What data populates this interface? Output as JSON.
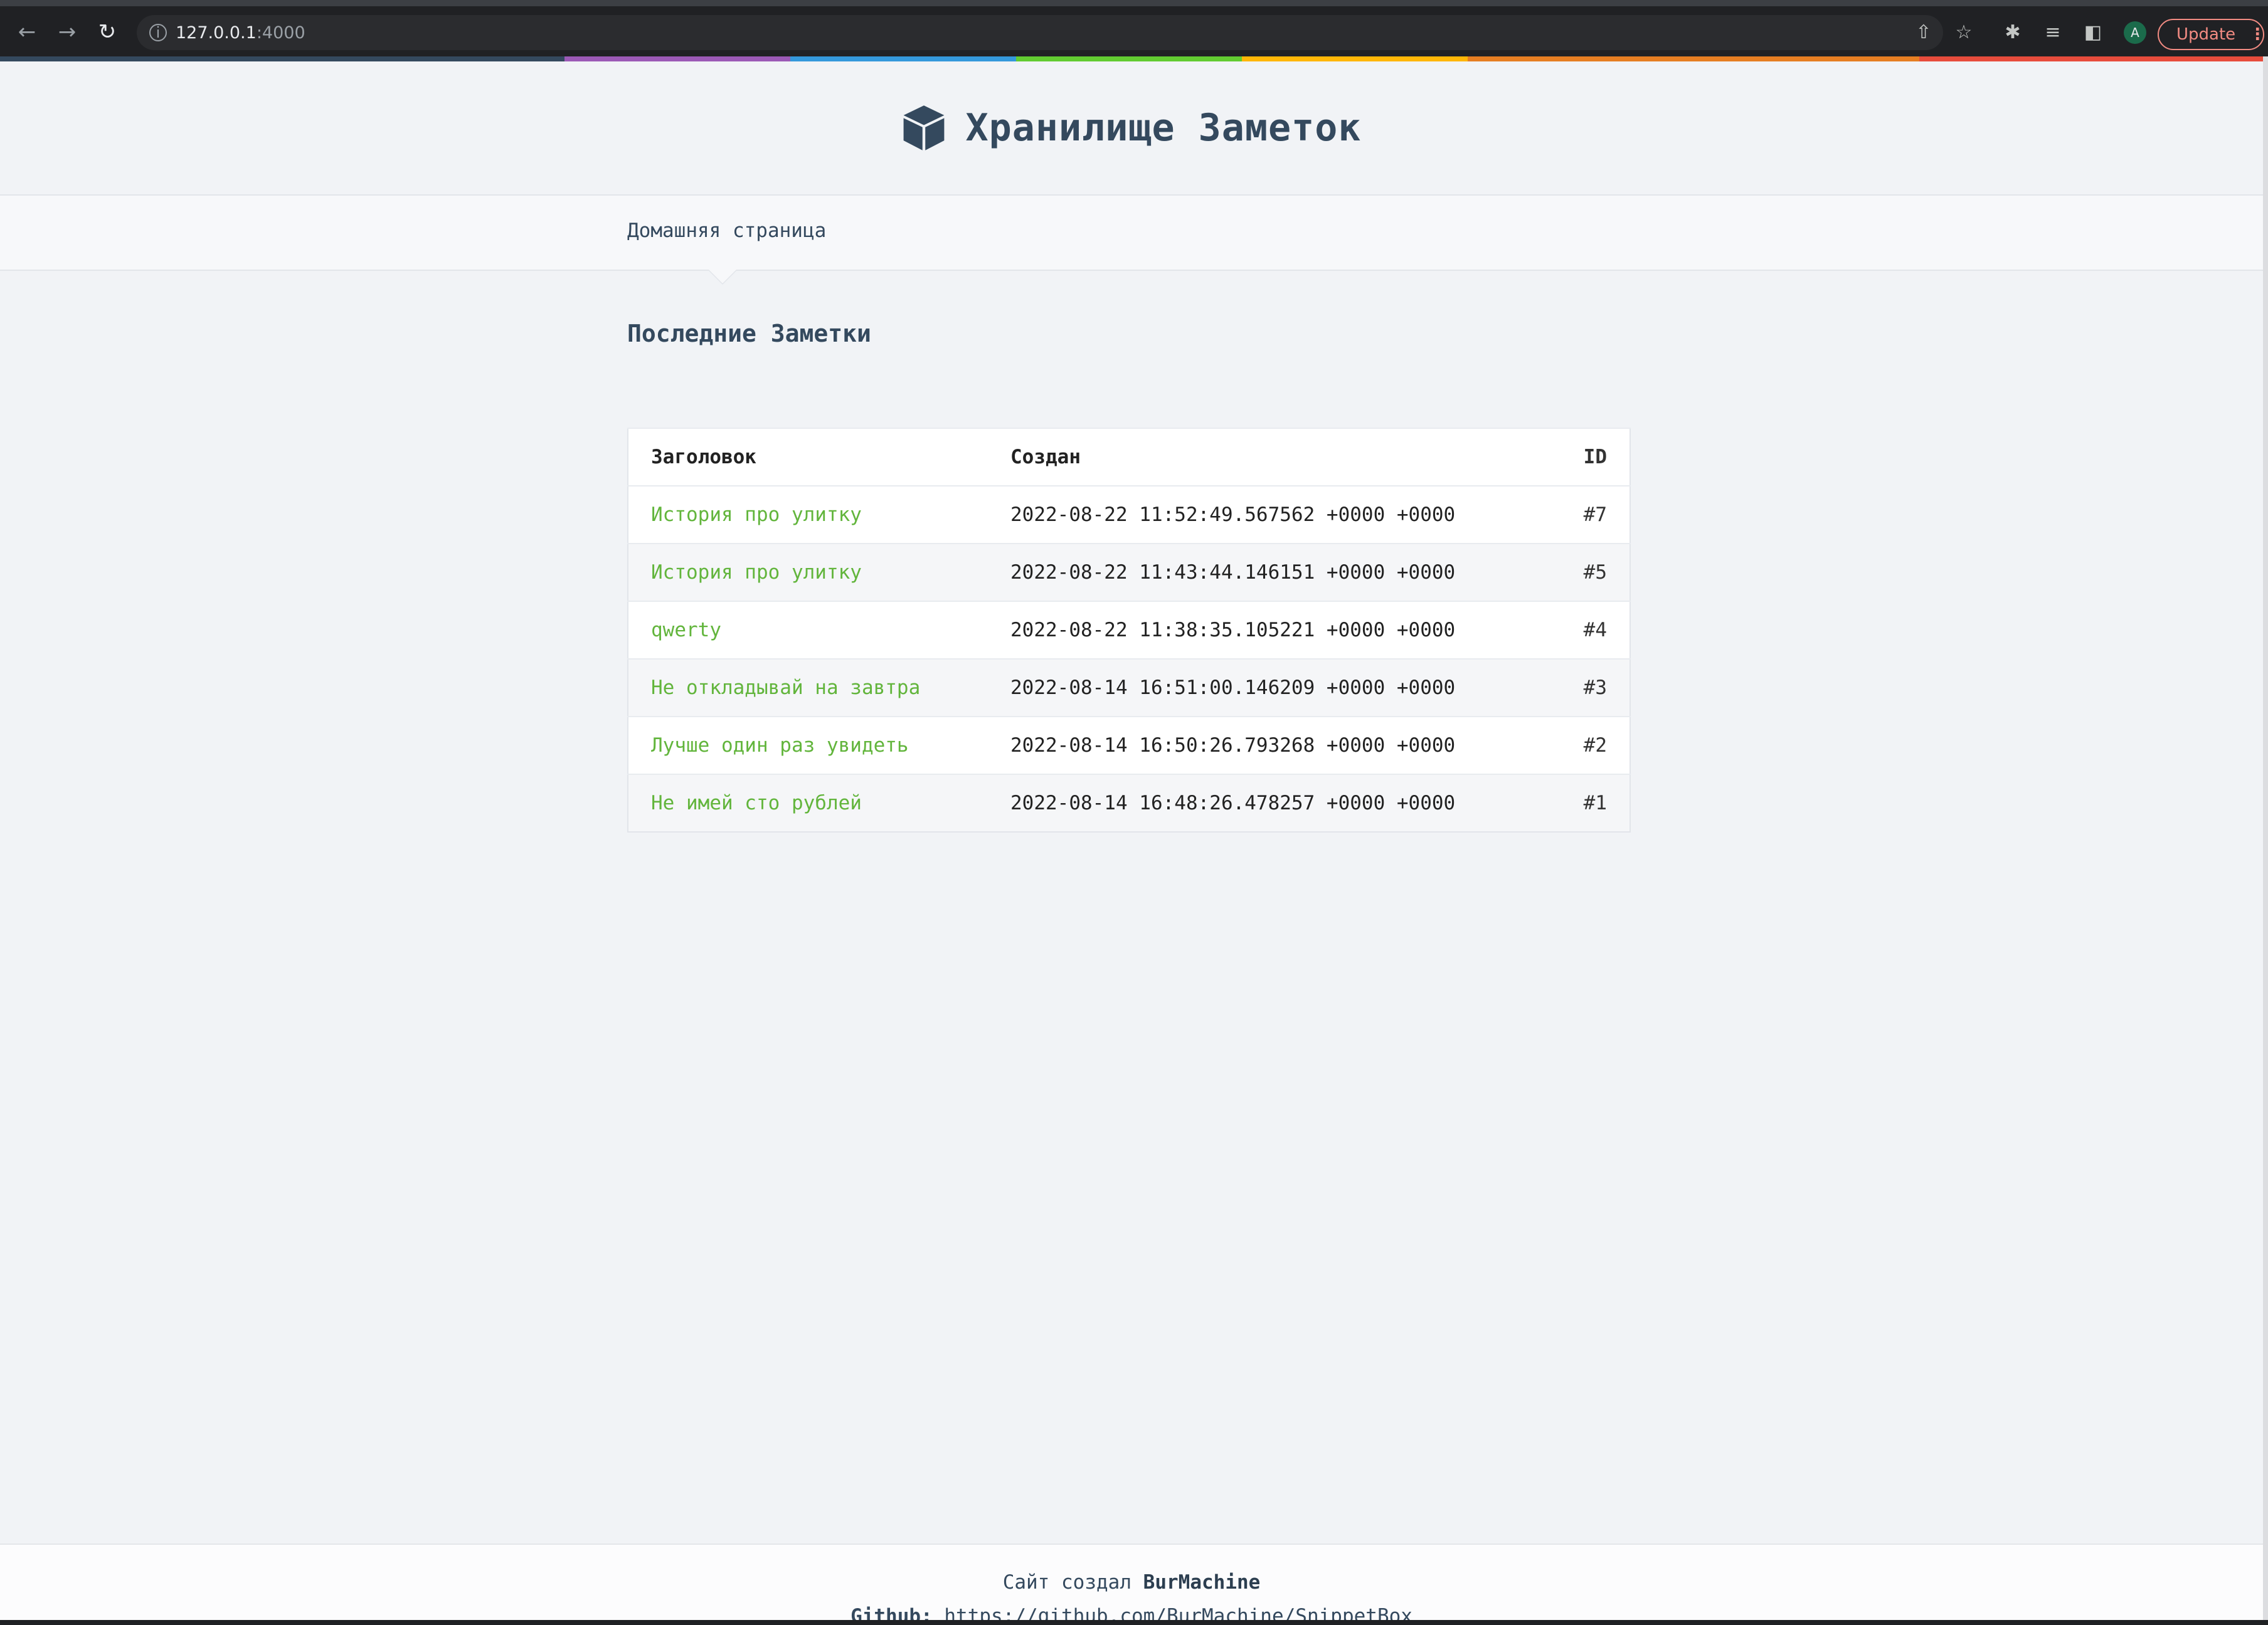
{
  "browser": {
    "url_host": "127.0.0.1",
    "url_port": ":4000",
    "update_label": "Update",
    "profile_initial": "A"
  },
  "rainbow_colors": [
    "#34495e",
    "#9b59b6",
    "#3498db",
    "#62cb31",
    "#ffb606",
    "#e67e22",
    "#e74c3c"
  ],
  "site": {
    "title": "Хранилище Заметок",
    "nav_home": "Домашняя страница"
  },
  "main": {
    "heading": "Последние Заметки",
    "table": {
      "headers": {
        "title": "Заголовок",
        "created": "Создан",
        "id": "ID"
      },
      "rows": [
        {
          "title": "История про улитку",
          "created": "2022-08-22 11:52:49.567562 +0000 +0000",
          "id": "#7"
        },
        {
          "title": "История про улитку",
          "created": "2022-08-22 11:43:44.146151 +0000 +0000",
          "id": "#5"
        },
        {
          "title": "qwerty",
          "created": "2022-08-22 11:38:35.105221 +0000 +0000",
          "id": "#4"
        },
        {
          "title": "Не откладывай на завтра",
          "created": "2022-08-14 16:51:00.146209 +0000 +0000",
          "id": "#3"
        },
        {
          "title": "Лучше один раз увидеть",
          "created": "2022-08-14 16:50:26.793268 +0000 +0000",
          "id": "#2"
        },
        {
          "title": "Не имей сто рублей",
          "created": "2022-08-14 16:48:26.478257 +0000 +0000",
          "id": "#1"
        }
      ]
    }
  },
  "footer": {
    "created_by_prefix": "Сайт создал",
    "author": "BurMachine",
    "github_label": "Github:",
    "github_url": "https://github.com/BurMachine/SnippetBox"
  }
}
